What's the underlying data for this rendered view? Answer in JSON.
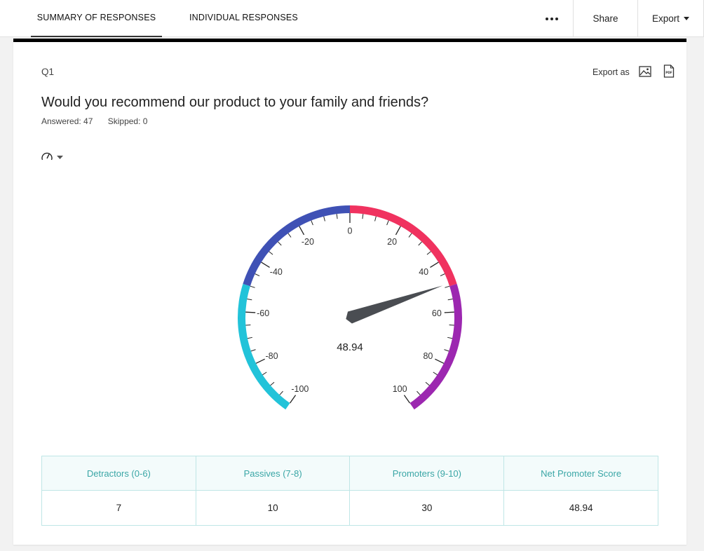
{
  "nav": {
    "tabs": [
      {
        "label": "SUMMARY OF RESPONSES",
        "active": true
      },
      {
        "label": "INDIVIDUAL RESPONSES",
        "active": false
      }
    ],
    "more_icon": "more-horizontal-icon",
    "share_label": "Share",
    "export_label": "Export"
  },
  "question": {
    "number": "Q1",
    "title": "Would you recommend our product to your family and friends?",
    "answered": "Answered: 47",
    "skipped": "Skipped: 0",
    "export_as_label": "Export as",
    "export_icons": [
      "image-icon",
      "pdf-icon"
    ],
    "chart_toggle_icon": "gauge-icon"
  },
  "chart_data": {
    "type": "gauge",
    "value": 48.94,
    "value_label": "48.94",
    "min": -100,
    "max": 100,
    "tick_labels": [
      "-100",
      "-80",
      "-60",
      "-40",
      "-20",
      "0",
      "20",
      "40",
      "60",
      "80",
      "100"
    ],
    "bands": [
      {
        "from": -100,
        "to": -50,
        "color": "#22c3d9"
      },
      {
        "from": -50,
        "to": 0,
        "color": "#3f51b5"
      },
      {
        "from": 0,
        "to": 50,
        "color": "#f0325f"
      },
      {
        "from": 50,
        "to": 100,
        "color": "#9c27b0"
      }
    ],
    "needle_color": "#4a4d52"
  },
  "table": {
    "headers": [
      "Detractors (0-6)",
      "Passives (7-8)",
      "Promoters (9-10)",
      "Net Promoter Score"
    ],
    "values": [
      "7",
      "10",
      "30",
      "48.94"
    ]
  }
}
